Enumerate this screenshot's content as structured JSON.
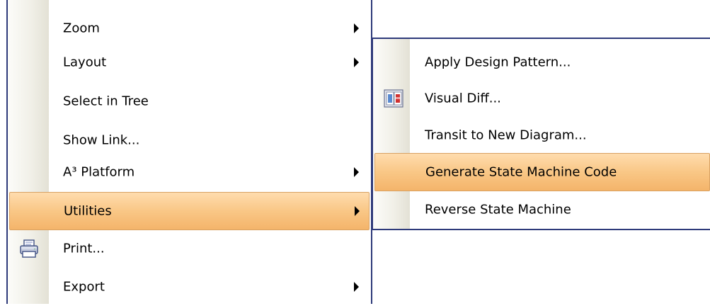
{
  "main_menu": {
    "items": [
      {
        "label": "Zoom",
        "submenu": true
      },
      {
        "label": "Layout",
        "submenu": true
      },
      {
        "label": "Select in Tree",
        "submenu": false
      },
      {
        "label": "Show Link...",
        "submenu": false
      },
      {
        "label": "A³ Platform",
        "submenu": true
      },
      {
        "label": "Utilities",
        "submenu": true,
        "highlighted": true
      },
      {
        "label": "Print...",
        "submenu": false,
        "icon": "printer-icon"
      },
      {
        "label": "Export",
        "submenu": true
      }
    ]
  },
  "sub_menu": {
    "items": [
      {
        "label": "Apply Design Pattern..."
      },
      {
        "label": "Visual Diff...",
        "icon": "visual-diff-icon"
      },
      {
        "label": "Transit to New Diagram..."
      },
      {
        "label": "Generate State Machine Code",
        "highlighted": true
      },
      {
        "label": "Reverse State Machine"
      }
    ]
  },
  "colors": {
    "highlight": "#f9c786",
    "menu_border": "#2e3a7a"
  }
}
